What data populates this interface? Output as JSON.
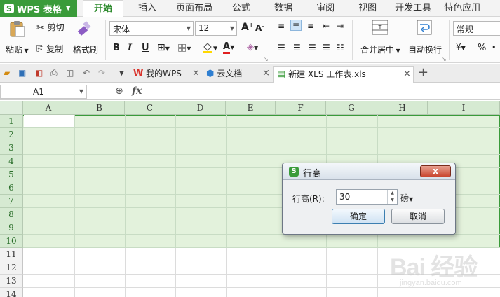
{
  "app": {
    "name": "WPS 表格",
    "logo_glyph": "S",
    "accent": "#3a9b3a"
  },
  "menu": {
    "items": [
      "开始",
      "插入",
      "页面布局",
      "公式",
      "数据",
      "审阅",
      "视图",
      "开发工具",
      "特色应用"
    ],
    "active": "开始"
  },
  "ribbon": {
    "paste": "粘贴",
    "cut": "剪切",
    "copy": "复制",
    "format_painter": "格式刷",
    "font_name": "宋体",
    "font_size": "12",
    "bold": "B",
    "italic": "I",
    "underline": "U",
    "merge_center": "合并居中",
    "wrap_text": "自动换行",
    "number_format": "常规",
    "percent": "%"
  },
  "tabs": {
    "items": [
      {
        "label": "我的WPS",
        "icon": "wps-logo-icon",
        "color": "#d9332b"
      },
      {
        "label": "云文档",
        "icon": "cloud-cube-icon",
        "color": "#2f7fd1"
      },
      {
        "label": "新建 XLS 工作表.xls",
        "icon": "sheet-file-icon",
        "color": "#3a9b3a"
      }
    ],
    "active_index": 2,
    "add": "+"
  },
  "formula_bar": {
    "name_box": "A1",
    "fx": "fx",
    "content": ""
  },
  "sheet": {
    "columns": [
      "A",
      "B",
      "C",
      "D",
      "E",
      "F",
      "G",
      "H",
      "I"
    ],
    "rows": [
      "1",
      "2",
      "3",
      "4",
      "5",
      "6",
      "7",
      "8",
      "9",
      "10",
      "11",
      "12",
      "13",
      "14"
    ],
    "selected_rows": [
      "1",
      "2",
      "3",
      "4",
      "5",
      "6",
      "7",
      "8",
      "9",
      "10"
    ],
    "selection_color": "#e3f2dc"
  },
  "dialog": {
    "title": "行高",
    "label": "行高(R):",
    "value": "30",
    "unit": "磅",
    "ok": "确定",
    "cancel": "取消",
    "close": "x"
  },
  "watermark": {
    "brand": "Bai 经验",
    "url": "jingyan.baidu.com"
  }
}
